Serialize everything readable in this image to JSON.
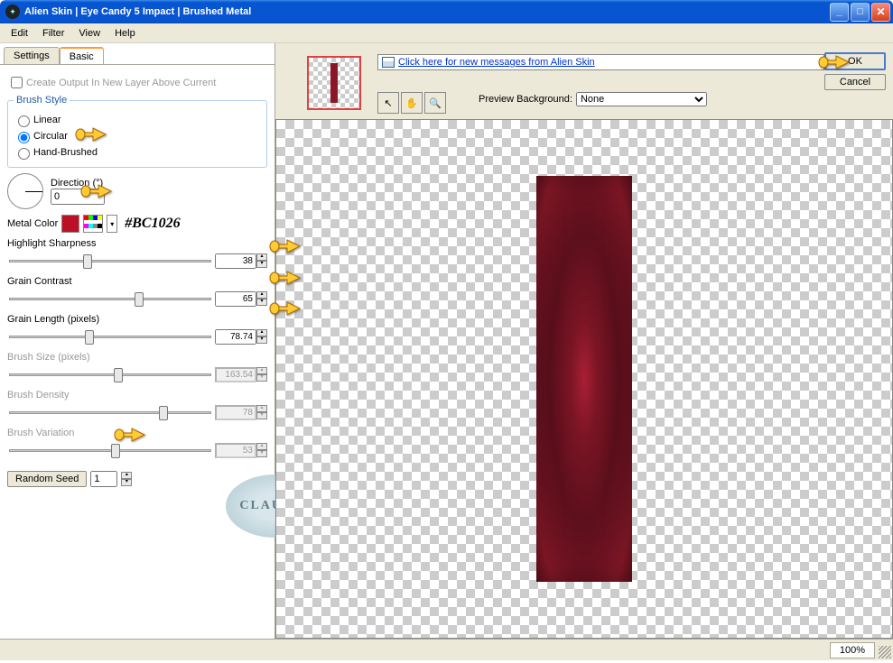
{
  "title": "Alien Skin  |  Eye Candy 5 Impact  |  Brushed Metal",
  "menu": {
    "edit": "Edit",
    "filter": "Filter",
    "view": "View",
    "help": "Help"
  },
  "tabs": {
    "settings": "Settings",
    "basic": "Basic"
  },
  "createOutput": "Create Output In New Layer Above Current",
  "brushStyle": {
    "legend": "Brush Style",
    "linear": "Linear",
    "circular": "Circular",
    "hand": "Hand-Brushed"
  },
  "direction": {
    "label": "Direction (°)",
    "value": "0"
  },
  "metalColor": {
    "label": "Metal Color",
    "hex": "#BC1026",
    "swatchColor": "#BC1026"
  },
  "sliders": {
    "highlight": {
      "label": "Highlight Sharpness",
      "value": "38"
    },
    "grainContrast": {
      "label": "Grain Contrast",
      "value": "65"
    },
    "grainLength": {
      "label": "Grain Length (pixels)",
      "value": "78.74"
    },
    "brushSize": {
      "label": "Brush Size (pixels)",
      "value": "163.54"
    },
    "brushDensity": {
      "label": "Brush Density",
      "value": "78"
    },
    "brushVariation": {
      "label": "Brush Variation",
      "value": "53"
    }
  },
  "randomSeed": {
    "button": "Random Seed",
    "value": "1"
  },
  "message": "Click here for new messages from Alien Skin",
  "buttons": {
    "ok": "OK",
    "cancel": "Cancel"
  },
  "previewBgLabel": "Preview Background:",
  "previewBgValue": "None",
  "zoom": "100%",
  "watermark": "CLAUDIA"
}
